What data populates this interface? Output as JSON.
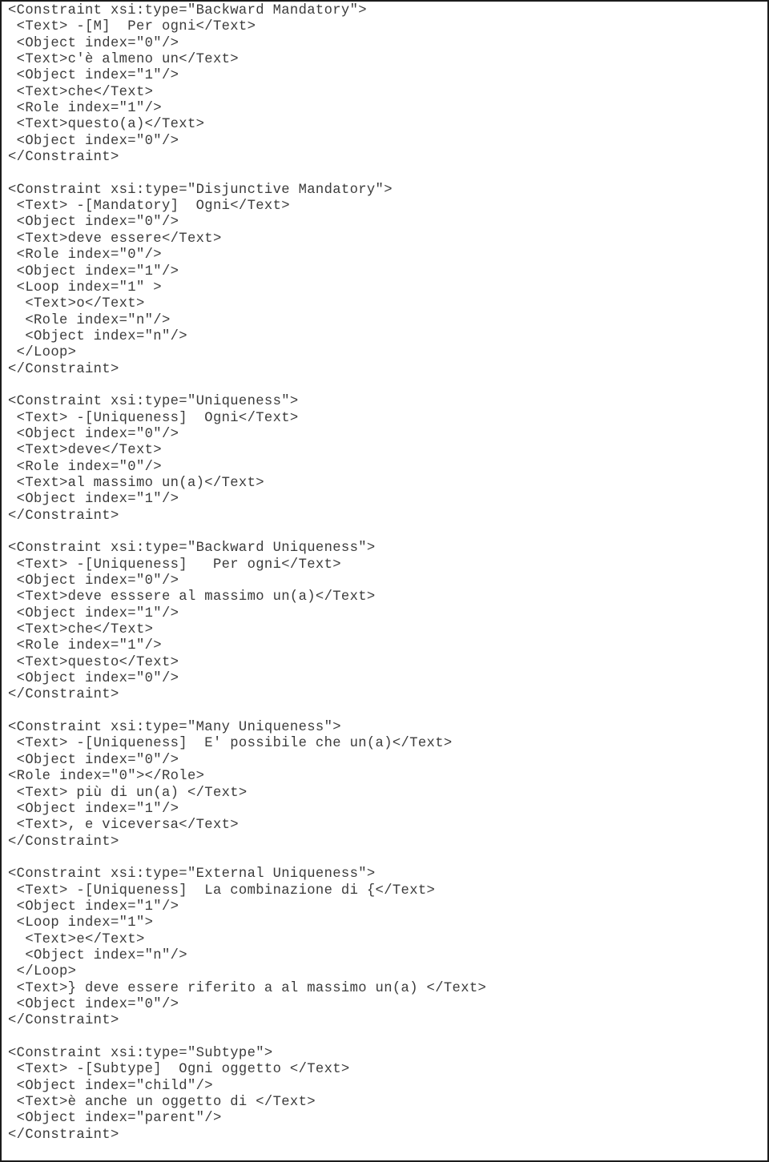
{
  "document": {
    "kind": "xml-code-listing",
    "language": "XML",
    "text_color": "#3b3b3b",
    "background_color": "#ffffff",
    "border_color": "#1c1c1c"
  },
  "listing": {
    "blocks": [
      {
        "name": "Backward Mandatory",
        "lines": [
          "<Constraint xsi:type=\"Backward Mandatory\">",
          " <Text> -[M]  Per ogni</Text>",
          " <Object index=\"0\"/>",
          " <Text>c'è almeno un</Text>",
          " <Object index=\"1\"/>",
          " <Text>che</Text>",
          " <Role index=\"1\"/>",
          " <Text>questo(a)</Text>",
          " <Object index=\"0\"/>",
          "</Constraint>"
        ]
      },
      {
        "name": "Disjunctive Mandatory",
        "lines": [
          "<Constraint xsi:type=\"Disjunctive Mandatory\">",
          " <Text> -[Mandatory]  Ogni</Text>",
          " <Object index=\"0\"/>",
          " <Text>deve essere</Text>",
          " <Role index=\"0\"/>",
          " <Object index=\"1\"/>",
          " <Loop index=\"1\" >",
          "  <Text>o</Text>",
          "  <Role index=\"n\"/>",
          "  <Object index=\"n\"/>",
          " </Loop>",
          "</Constraint>"
        ]
      },
      {
        "name": "Uniqueness",
        "lines": [
          "<Constraint xsi:type=\"Uniqueness\">",
          " <Text> -[Uniqueness]  Ogni</Text>",
          " <Object index=\"0\"/>",
          " <Text>deve</Text>",
          " <Role index=\"0\"/>",
          " <Text>al massimo un(a)</Text>",
          " <Object index=\"1\"/>",
          "</Constraint>"
        ]
      },
      {
        "name": "Backward Uniqueness",
        "lines": [
          "<Constraint xsi:type=\"Backward Uniqueness\">",
          " <Text> -[Uniqueness]   Per ogni</Text>",
          " <Object index=\"0\"/>",
          " <Text>deve esssere al massimo un(a)</Text>",
          " <Object index=\"1\"/>",
          " <Text>che</Text>",
          " <Role index=\"1\"/>",
          " <Text>questo</Text>",
          " <Object index=\"0\"/>",
          "</Constraint>"
        ]
      },
      {
        "name": "Many Uniqueness",
        "lines": [
          "<Constraint xsi:type=\"Many Uniqueness\">",
          " <Text> -[Uniqueness]  E' possibile che un(a)</Text>",
          " <Object index=\"0\"/>",
          "<Role index=\"0\"></Role>",
          " <Text> più di un(a) </Text>",
          " <Object index=\"1\"/>",
          " <Text>, e viceversa</Text>",
          "</Constraint>"
        ]
      },
      {
        "name": "External Uniqueness",
        "lines": [
          "<Constraint xsi:type=\"External Uniqueness\">",
          " <Text> -[Uniqueness]  La combinazione di {</Text>",
          " <Object index=\"1\"/>",
          " <Loop index=\"1\">",
          "  <Text>e</Text>",
          "  <Object index=\"n\"/>",
          " </Loop>",
          " <Text>} deve essere riferito a al massimo un(a) </Text>",
          " <Object index=\"0\"/>",
          "</Constraint>"
        ]
      },
      {
        "name": "Subtype",
        "lines": [
          "<Constraint xsi:type=\"Subtype\">",
          " <Text> -[Subtype]  Ogni oggetto </Text>",
          " <Object index=\"child\"/>",
          " <Text>è anche un oggetto di </Text>",
          " <Object index=\"parent\"/>",
          "</Constraint>"
        ]
      }
    ]
  }
}
